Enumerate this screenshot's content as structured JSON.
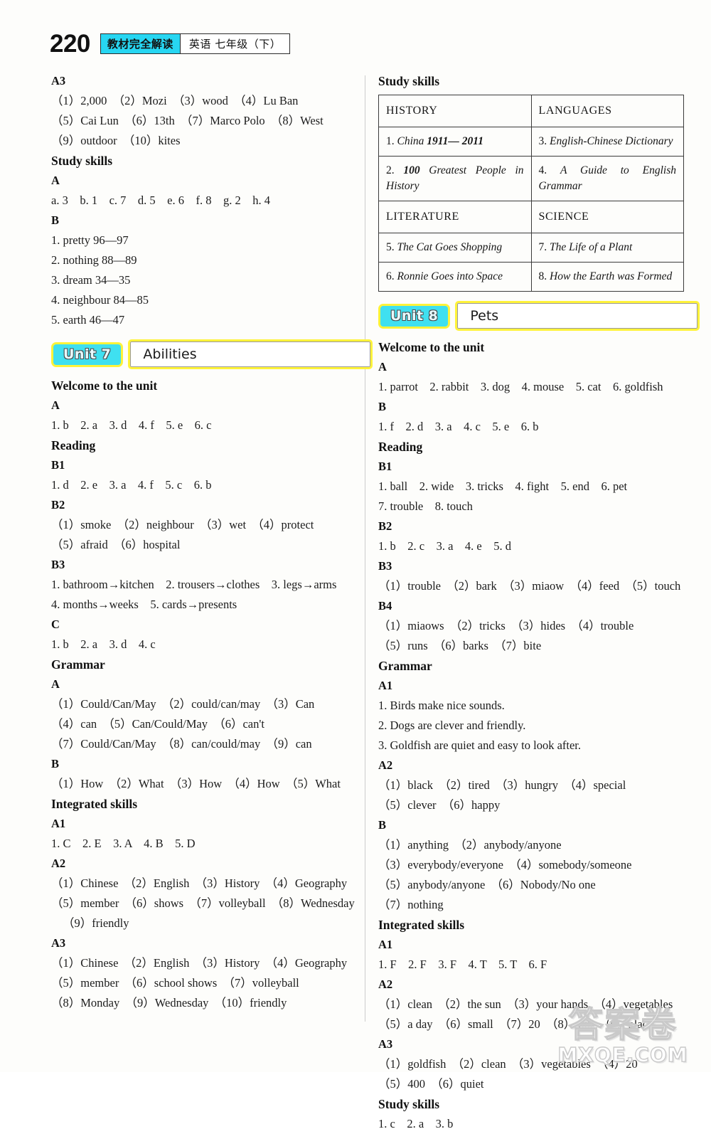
{
  "header": {
    "page_number": "220",
    "brand": "教材完全解读",
    "subject": "英语 七年级（下）",
    "brand_color": "#27d6f2"
  },
  "left_column": {
    "blocks": [
      {
        "kind": "sub-head",
        "text": "A3"
      },
      {
        "kind": "answer",
        "text": "（1）2,000　（2）Mozi　（3）wood　（4）Lu Ban"
      },
      {
        "kind": "answer",
        "text": "（5）Cai Lun　（6）13th　（7）Marco Polo　（8）West"
      },
      {
        "kind": "answer",
        "text": "（9）outdoor　（10）kites"
      },
      {
        "kind": "sec-head",
        "text": "Study skills"
      },
      {
        "kind": "sub-head",
        "text": "A"
      },
      {
        "kind": "answer",
        "text": "a. 3　b. 1　c. 7　d. 5　e. 6　f. 8　g. 2　h. 4"
      },
      {
        "kind": "sub-head",
        "text": "B"
      },
      {
        "kind": "answer",
        "text": "1. pretty 96—97"
      },
      {
        "kind": "answer",
        "text": "2. nothing 88—89"
      },
      {
        "kind": "answer",
        "text": "3. dream 34—35"
      },
      {
        "kind": "answer",
        "text": "4. neighbour 84—85"
      },
      {
        "kind": "answer",
        "text": "5. earth 46—47"
      },
      {
        "kind": "unit-banner",
        "chip": "Unit 7",
        "title": "Abilities"
      },
      {
        "kind": "sec-head",
        "text": "Welcome to the unit"
      },
      {
        "kind": "sub-head",
        "text": "A"
      },
      {
        "kind": "answer",
        "text": "1. b　2. a　3. d　4. f　5. e　6. c"
      },
      {
        "kind": "sec-head",
        "text": "Reading"
      },
      {
        "kind": "sub-head",
        "text": "B1"
      },
      {
        "kind": "answer",
        "text": "1. d　2. e　3. a　4. f　5. c　6. b"
      },
      {
        "kind": "sub-head",
        "text": "B2"
      },
      {
        "kind": "answer",
        "text": "（1）smoke　（2）neighbour　（3）wet　（4）protect"
      },
      {
        "kind": "answer",
        "text": "（5）afraid　（6）hospital"
      },
      {
        "kind": "sub-head",
        "text": "B3"
      },
      {
        "kind": "answer",
        "text": "1. bathroom→kitchen　2. trousers→clothes　3. legs→arms"
      },
      {
        "kind": "answer",
        "text": "4. months→weeks　5. cards→presents"
      },
      {
        "kind": "sub-head",
        "text": "C"
      },
      {
        "kind": "answer",
        "text": "1. b　2. a　3. d　4. c"
      },
      {
        "kind": "sec-head",
        "text": "Grammar"
      },
      {
        "kind": "sub-head",
        "text": "A"
      },
      {
        "kind": "answer",
        "text": "（1）Could/Can/May　（2）could/can/may　（3）Can"
      },
      {
        "kind": "answer",
        "text": "（4）can　（5）Can/Could/May　（6）can't"
      },
      {
        "kind": "answer",
        "text": "（7）Could/Can/May　（8）can/could/may　（9）can"
      },
      {
        "kind": "sub-head",
        "text": "B"
      },
      {
        "kind": "answer",
        "text": "（1）How　（2）What　（3）How　（4）How　（5）What"
      },
      {
        "kind": "sec-head",
        "text": "Integrated skills"
      },
      {
        "kind": "sub-head",
        "text": "A1"
      },
      {
        "kind": "answer",
        "text": "1. C　2. E　3. A　4. B　5. D"
      },
      {
        "kind": "sub-head",
        "text": "A2"
      },
      {
        "kind": "answer",
        "text": "（1）Chinese　（2）English　（3）History　（4）Geography"
      },
      {
        "kind": "answer",
        "text": "（5）member　（6）shows　（7）volleyball　（8）Wednesday"
      },
      {
        "kind": "answer-indent",
        "text": "（9）friendly"
      },
      {
        "kind": "sub-head",
        "text": "A3"
      },
      {
        "kind": "answer",
        "text": "（1）Chinese　（2）English　（3）History　（4）Geography"
      },
      {
        "kind": "answer",
        "text": "（5）member　（6）school shows　（7）volleyball"
      },
      {
        "kind": "answer",
        "text": "（8）Monday　（9）Wednesday　（10）friendly"
      }
    ]
  },
  "right_column": {
    "study_skills_heading": "Study skills",
    "study_skills_table": {
      "rows": [
        [
          {
            "type": "category",
            "text": "HISTORY"
          },
          {
            "type": "category",
            "text": "LANGUAGES"
          }
        ],
        [
          {
            "type": "item",
            "number": "1.",
            "title": "China",
            "emphasis": "1911— 2011"
          },
          {
            "type": "item",
            "number": "3.",
            "title": "English-Chinese Dictionary",
            "emphasis": ""
          }
        ],
        [
          {
            "type": "item",
            "number": "2.",
            "title": "Greatest People in History",
            "emphasis": "100"
          },
          {
            "type": "item",
            "number": "4.",
            "title": "A Guide to English Grammar",
            "emphasis": ""
          }
        ],
        [
          {
            "type": "category",
            "text": "LITERATURE"
          },
          {
            "type": "category",
            "text": "SCIENCE"
          }
        ],
        [
          {
            "type": "item",
            "number": "5.",
            "title": "The Cat Goes Shopping",
            "emphasis": ""
          },
          {
            "type": "item",
            "number": "7.",
            "title": "The Life of a Plant",
            "emphasis": ""
          }
        ],
        [
          {
            "type": "item",
            "number": "6.",
            "title": "Ronnie Goes into Space",
            "emphasis": ""
          },
          {
            "type": "item",
            "number": "8.",
            "title": "How the Earth was Formed",
            "emphasis": ""
          }
        ]
      ]
    },
    "blocks": [
      {
        "kind": "unit-banner",
        "chip": "Unit 8",
        "title": "Pets"
      },
      {
        "kind": "sec-head",
        "text": "Welcome to the unit"
      },
      {
        "kind": "sub-head",
        "text": "A"
      },
      {
        "kind": "answer",
        "text": "1. parrot　2. rabbit　3. dog　4. mouse　5. cat　6. goldfish"
      },
      {
        "kind": "sub-head",
        "text": "B"
      },
      {
        "kind": "answer",
        "text": "1. f　2. d　3. a　4. c　5. e　6. b"
      },
      {
        "kind": "sec-head",
        "text": "Reading"
      },
      {
        "kind": "sub-head",
        "text": "B1"
      },
      {
        "kind": "answer",
        "text": "1. ball　2. wide　3. tricks　4. fight　5. end　6. pet"
      },
      {
        "kind": "answer",
        "text": "7. trouble　8. touch"
      },
      {
        "kind": "sub-head",
        "text": "B2"
      },
      {
        "kind": "answer",
        "text": "1. b　2. c　3. a　4. e　5. d"
      },
      {
        "kind": "sub-head",
        "text": "B3"
      },
      {
        "kind": "answer",
        "text": "（1）trouble　（2）bark　（3）miaow　（4）feed　（5）touch"
      },
      {
        "kind": "sub-head",
        "text": "B4"
      },
      {
        "kind": "answer",
        "text": "（1）miaows　（2）tricks　（3）hides　（4）trouble"
      },
      {
        "kind": "answer",
        "text": "（5）runs　（6）barks　（7）bite"
      },
      {
        "kind": "sec-head",
        "text": "Grammar"
      },
      {
        "kind": "sub-head",
        "text": "A1"
      },
      {
        "kind": "answer",
        "text": "1. Birds make nice sounds."
      },
      {
        "kind": "answer",
        "text": "2. Dogs are clever and friendly."
      },
      {
        "kind": "answer",
        "text": "3. Goldfish are quiet and easy to look after."
      },
      {
        "kind": "sub-head",
        "text": "A2"
      },
      {
        "kind": "answer",
        "text": "（1）black　（2）tired　（3）hungry　（4）special"
      },
      {
        "kind": "answer",
        "text": "（5）clever　（6）happy"
      },
      {
        "kind": "sub-head",
        "text": "B"
      },
      {
        "kind": "answer",
        "text": "（1）anything　（2）anybody/anyone"
      },
      {
        "kind": "answer",
        "text": "（3）everybody/everyone　（4）somebody/someone"
      },
      {
        "kind": "answer",
        "text": "（5）anybody/anyone　（6）Nobody/No one"
      },
      {
        "kind": "answer",
        "text": "（7）nothing"
      },
      {
        "kind": "sec-head",
        "text": "Integrated skills"
      },
      {
        "kind": "sub-head",
        "text": "A1"
      },
      {
        "kind": "answer",
        "text": "1. F　2. F　3. F　4. T　5. T　6. F"
      },
      {
        "kind": "sub-head",
        "text": "A2"
      },
      {
        "kind": "answer",
        "text": "（1）clean　（2）the sun　（3）your hands　（4）vegetables"
      },
      {
        "kind": "answer",
        "text": "（5）a day　（6）small　（7）20　（8）400　（9）black"
      },
      {
        "kind": "sub-head",
        "text": "A3"
      },
      {
        "kind": "answer",
        "text": "（1）goldfish　（2）clean　（3）vegetables　（4）20"
      },
      {
        "kind": "answer",
        "text": "（5）400　（6）quiet"
      },
      {
        "kind": "sec-head",
        "text": "Study skills"
      },
      {
        "kind": "answer",
        "text": "1. c　2. a　3. b"
      }
    ]
  },
  "watermark": {
    "chinese": "答案卷",
    "latin": "MXQE.COM"
  }
}
